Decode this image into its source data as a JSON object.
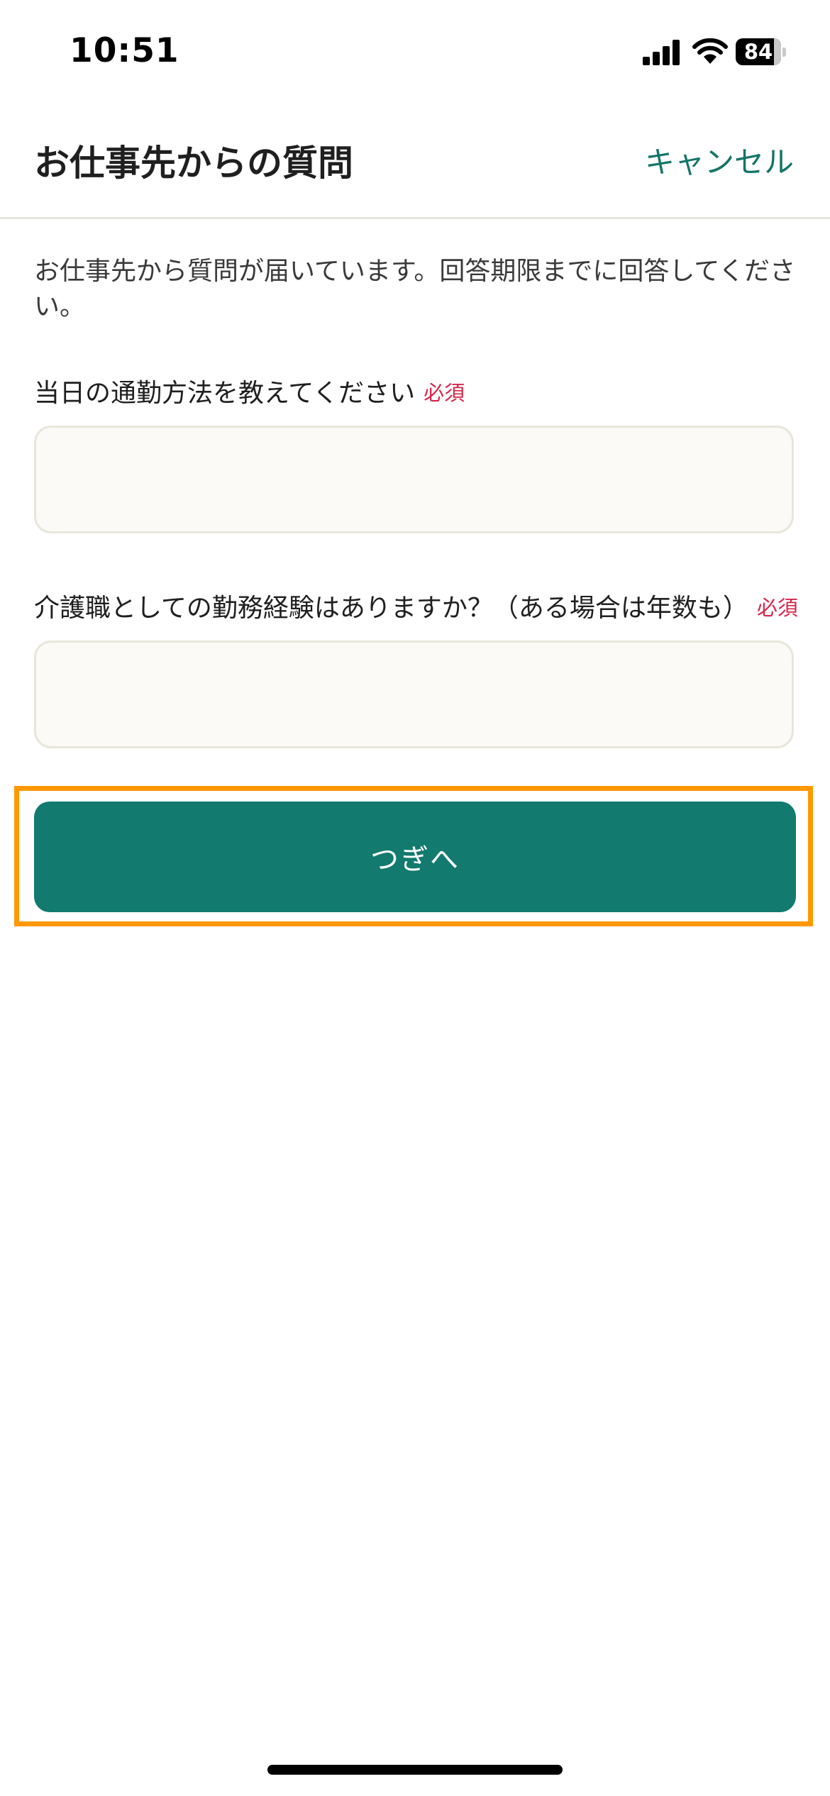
{
  "status_bar": {
    "time": "10:51",
    "battery_level": "84",
    "battery_fraction": 0.84
  },
  "header": {
    "title": "お仕事先からの質問",
    "cancel_label": "キャンセル"
  },
  "intro_text": "お仕事先から質問が届いています。回答期限までに回答してください。",
  "questions": [
    {
      "label": "当日の通勤方法を教えてください",
      "required_label": "必須",
      "value": ""
    },
    {
      "label": "介護職としての勤務経験はありますか？（ある場合は年数も）",
      "required_label": "必須",
      "value": ""
    }
  ],
  "next_button": {
    "label": "つぎへ"
  },
  "colors": {
    "accent": "#127a6e",
    "required": "#d6254a",
    "highlight": "#ff9800"
  }
}
